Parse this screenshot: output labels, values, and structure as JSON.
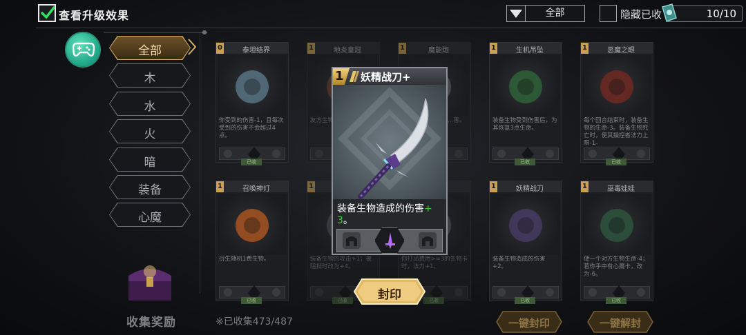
{
  "topbar": {
    "upgrade_label": "查看升级效果",
    "filter_value": "全部",
    "hide_label": "隐藏已收",
    "counter": "10/10"
  },
  "categories": [
    {
      "label": "全部",
      "active": true
    },
    {
      "label": "木",
      "active": false
    },
    {
      "label": "水",
      "active": false
    },
    {
      "label": "火",
      "active": false
    },
    {
      "label": "暗",
      "active": false
    },
    {
      "label": "装备",
      "active": false
    },
    {
      "label": "心魔",
      "active": false
    }
  ],
  "reward_label": "收集奖励",
  "collected": "※已收集473/487",
  "cards": [
    {
      "cost": "0",
      "name": "泰坦结界",
      "desc": "你受到的伤害-1，且每次受到的伤害不会超过4点。",
      "tag": "已收"
    },
    {
      "cost": "1",
      "name": "地炎皇冠",
      "desc": "友方生物...生命-2...",
      "tag": "已收"
    },
    {
      "cost": "1",
      "name": "魔能炮",
      "desc": "...抽卡，...同于该...害。",
      "tag": "已收"
    },
    {
      "cost": "1",
      "name": "生机吊坠",
      "desc": "装备生物受到伤害后，为其恢复3点生命。",
      "tag": "已收"
    },
    {
      "cost": "1",
      "name": "恶魔之眼",
      "desc": "每个回合结束时，装备生物的生命-3。装备生物死亡时，使其操控者法力上限-1。",
      "tag": "已收"
    },
    {
      "cost": "1",
      "name": "召唤神灯",
      "desc": "衍生随机1费生物。",
      "tag": "已收"
    },
    {
      "cost": "1",
      "name": "",
      "desc": "装备生物的攻击+1；被阻挡时改为+4。",
      "tag": "已收"
    },
    {
      "cost": "1",
      "name": "",
      "desc": "你打出费用>=3的生物卡时，法力+1。",
      "tag": "已收"
    },
    {
      "cost": "1",
      "name": "妖精战刀",
      "desc": "装备生物造成的伤害+2。",
      "tag": "已收"
    },
    {
      "cost": "1",
      "name": "巫毒娃娃",
      "desc": "使一个对方生物生命-4；若你手中有心魔卡，改为-6。",
      "tag": "已收"
    }
  ],
  "popup": {
    "cost": "1",
    "title": "妖精战刀+",
    "desc_main": "装备生物造成的伤害",
    "desc_plus": "+",
    "desc_value": "3",
    "desc_end": "。",
    "seal_label": "封印"
  },
  "bottom": {
    "seal_all_label": "一键封印",
    "unseal_all_label": "一键解封"
  },
  "colors": {
    "accent_gold": "#d7b26a",
    "highlight_green": "#35d43a",
    "gamepad_teal": "#1da486"
  }
}
